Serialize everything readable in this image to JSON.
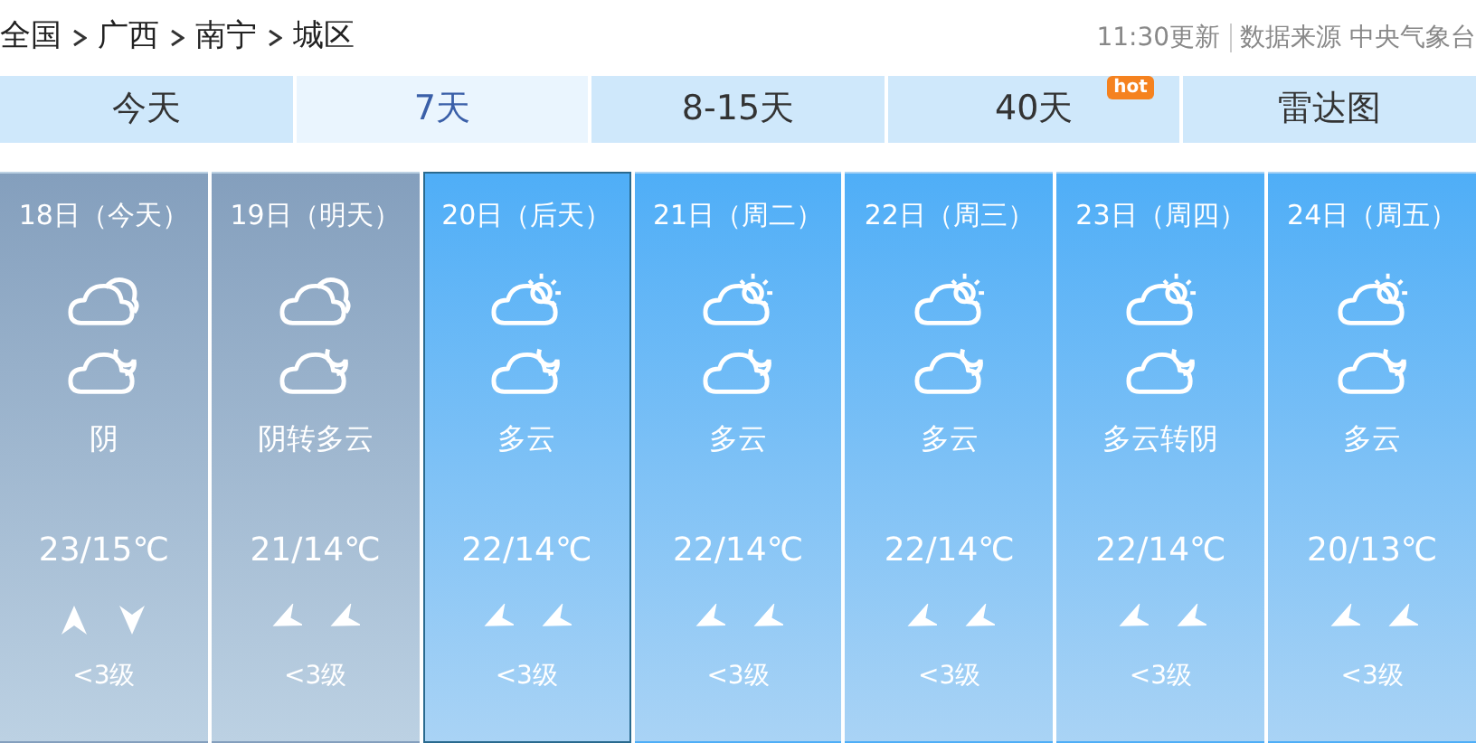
{
  "breadcrumb": [
    "全国",
    "广西",
    "南宁",
    "城区"
  ],
  "updated": "11:30更新",
  "source": "数据来源 中央气象台",
  "tabs": [
    {
      "label": "今天",
      "selected": false
    },
    {
      "label": "7天",
      "selected": true
    },
    {
      "label": "8-15天",
      "selected": false
    },
    {
      "label": "40天",
      "selected": false,
      "badge": "hot"
    },
    {
      "label": "雷达图",
      "selected": false
    }
  ],
  "days": [
    {
      "date": "18日（今天）",
      "kind": "overcast",
      "selected": false,
      "day_icon": {
        "kind": "cloudy"
      },
      "night_icon": {
        "kind": "moon-cloud"
      },
      "weather": "阴",
      "temp": "23/15℃",
      "wind": [
        {
          "kind": "north"
        },
        {
          "kind": "south"
        }
      ],
      "level": "<3级"
    },
    {
      "date": "19日（明天）",
      "kind": "overcast",
      "selected": false,
      "day_icon": {
        "kind": "cloudy"
      },
      "night_icon": {
        "kind": "moon-cloud"
      },
      "weather": "阴转多云",
      "temp": "21/14℃",
      "wind": [
        {
          "kind": "southwest"
        },
        {
          "kind": "southwest"
        }
      ],
      "level": "<3级"
    },
    {
      "date": "20日（后天）",
      "kind": "clear",
      "selected": true,
      "day_icon": {
        "kind": "sun-cloud"
      },
      "night_icon": {
        "kind": "moon-cloud"
      },
      "weather": "多云",
      "temp": "22/14℃",
      "wind": [
        {
          "kind": "southwest"
        },
        {
          "kind": "southwest"
        }
      ],
      "level": "<3级"
    },
    {
      "date": "21日（周二）",
      "kind": "clear",
      "selected": false,
      "day_icon": {
        "kind": "sun-cloud"
      },
      "night_icon": {
        "kind": "moon-cloud"
      },
      "weather": "多云",
      "temp": "22/14℃",
      "wind": [
        {
          "kind": "southwest"
        },
        {
          "kind": "southwest"
        }
      ],
      "level": "<3级"
    },
    {
      "date": "22日（周三）",
      "kind": "clear",
      "selected": false,
      "day_icon": {
        "kind": "sun-cloud"
      },
      "night_icon": {
        "kind": "moon-cloud"
      },
      "weather": "多云",
      "temp": "22/14℃",
      "wind": [
        {
          "kind": "southwest"
        },
        {
          "kind": "southwest"
        }
      ],
      "level": "<3级"
    },
    {
      "date": "23日（周四）",
      "kind": "clear",
      "selected": false,
      "day_icon": {
        "kind": "sun-cloud"
      },
      "night_icon": {
        "kind": "moon-cloud"
      },
      "weather": "多云转阴",
      "temp": "22/14℃",
      "wind": [
        {
          "kind": "southwest"
        },
        {
          "kind": "southwest"
        }
      ],
      "level": "<3级"
    },
    {
      "date": "24日（周五）",
      "kind": "clear",
      "selected": false,
      "day_icon": {
        "kind": "sun-cloud"
      },
      "night_icon": {
        "kind": "moon-cloud"
      },
      "weather": "多云",
      "temp": "20/13℃",
      "wind": [
        {
          "kind": "southwest"
        },
        {
          "kind": "southwest"
        }
      ],
      "level": "<3级"
    }
  ]
}
